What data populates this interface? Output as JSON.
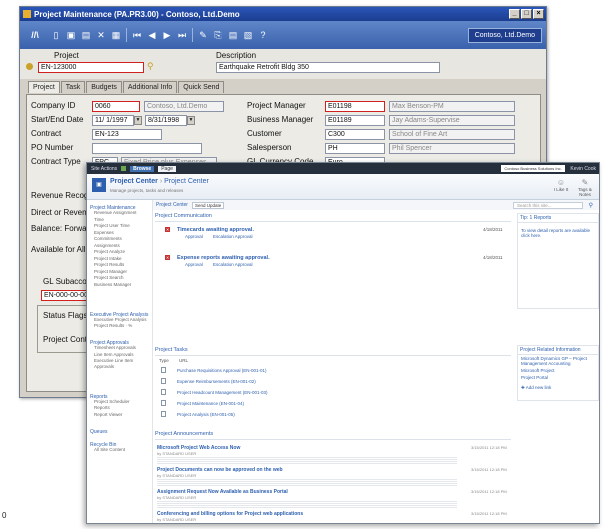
{
  "window": {
    "title": "Project Maintenance (PA.PR3.00) - Contoso, Ltd.Demo",
    "company_button": "Contoso, Ltd.Demo"
  },
  "header": {
    "project_label": "Project",
    "project_value": "EN-123000",
    "description_label": "Description",
    "description_value": "Earthquake Retrofit Bldg 350"
  },
  "tabs": [
    "Project",
    "Task",
    "Budgets",
    "Additional Info",
    "Quick Send"
  ],
  "form": {
    "company_id_label": "Company ID",
    "company_id_value": "0060",
    "company_name": "Contoso, Ltd.Demo",
    "dates_label": "Start/End Date",
    "start_date": "11/ 1/1997",
    "end_date": "8/31/1998",
    "contract_label": "Contract",
    "contract_value": "EN-123",
    "po_label": "PO Number",
    "contract_type_label": "Contract Type",
    "contract_type_code": "FPC",
    "contract_type_desc": "Fixed Price plus Expenses",
    "pm_label": "Project Manager",
    "pm_id": "E01198",
    "pm_name": "Max Benson-PM",
    "bm_label": "Business Manager",
    "bm_id": "E01189",
    "bm_name": "Jay Adams-Supervise",
    "customer_label": "Customer",
    "customer_id": "C300",
    "customer_name": "School of Fine Art",
    "salesperson_label": "Salesperson",
    "salesperson_id": "PH",
    "salesperson_name": "Phil Spencer",
    "gl_currency_label": "GL Currency Code",
    "gl_currency_value": "Euro",
    "revenue_label": "Revenue Recog",
    "direct_label": "Direct or Revenue",
    "balance_label": "Balance: Forwa",
    "available_label": "Available for All",
    "gl_sub_label": "GL Subaccount",
    "gl_sub_value": "EN-000-00-000",
    "status_label": "Status Flags",
    "project_contract_label": "Project Contr"
  },
  "ps": {
    "topbar": {
      "site_actions": "Site Actions",
      "browse_tab": "Browse",
      "page_tab": "Page",
      "search_text": "Contoso Business Solutions Inc.",
      "user": "Kevin Cook"
    },
    "site_title": "Project Center",
    "breadcrumb_sep": "›",
    "site_title2": "Project Center",
    "site_subtitle": "Manage projects, tasks and releases",
    "ribbon_like": "I Like It",
    "ribbon_tags": "Tags & Notes",
    "mainbar": {
      "label": "Project Center",
      "button": "Send Update"
    },
    "search_placeholder": "Search this site...",
    "nav": [
      {
        "head": "Project Maintenance",
        "items": [
          "Revenue Assignment",
          "Time",
          "Project User Time",
          "Expenses",
          "Commitments",
          "Assignments",
          "Project Analyze",
          "Project Intake",
          "Project Results",
          "Project Manager",
          "Project Search",
          "Business Manager"
        ]
      },
      {
        "head": "Executive Project Analysis",
        "items": [
          "Executive Project Analysis",
          "Project Results · %"
        ]
      },
      {
        "head": "Project Approvals",
        "items": [
          "Timesheet Approvals",
          "Line Item Approvals",
          "Executive Line Item Approvals"
        ]
      },
      {
        "head": "Reports",
        "items": [
          "Project Scheduler",
          "Reports",
          "Report Viewer"
        ]
      },
      {
        "head": "Queues",
        "items": []
      },
      {
        "head": "Recycle Bin",
        "items": [
          "All Site Content"
        ]
      }
    ],
    "communication_header": "Project Communication",
    "comm_items": [
      {
        "title": "Timecards awaiting approval.",
        "date": "4/18/2011",
        "approve": "Approval",
        "escalate": "Escalation Approval"
      },
      {
        "title": "Expense reports awaiting approval.",
        "date": "4/18/2011",
        "approve": "Approval",
        "escalate": "Escalation Approval"
      }
    ],
    "tasks_header": "Project Tasks",
    "task_cols": [
      "Type",
      "URL"
    ],
    "task_rows": [
      "Purchase Requisitions Approval (EN-001-01)",
      "Expense Reimbursements (EN-001-02)",
      "Project Headcount Management (EN-001-03)",
      "Project Maintenance (EN-001-04)",
      "Project Analysis (EN-001-05)"
    ],
    "ann_header": "Project Announcements",
    "announcements": [
      {
        "title": "Microsoft Project Web Access Now",
        "meta": "by STANDARD USER",
        "date": "3/15/2011 12:18 PM"
      },
      {
        "title": "Project Documents can now be approved on the web",
        "meta": "by STANDARD USER",
        "date": "3/15/2011 12:18 PM"
      },
      {
        "title": "Assignment Request Now Available as Business Portal",
        "meta": "by STANDARD USER",
        "date": "3/15/2011 12:18 PM"
      },
      {
        "title": "Conferencing and billing options for Project web applications",
        "meta": "by STANDARD USER",
        "date": "3/15/2011 12:18 PM"
      }
    ],
    "right": {
      "tip_header": "Tip: 1 Reports",
      "tip_text": "To view detail reports are available click here.",
      "related_header": "Project Related Information",
      "related_items": [
        "Microsoft Dynamics GP – Project Management Accounting",
        "Microsoft Project",
        "Project Portal"
      ],
      "add_link": "Add new link"
    }
  },
  "page_number": "0"
}
